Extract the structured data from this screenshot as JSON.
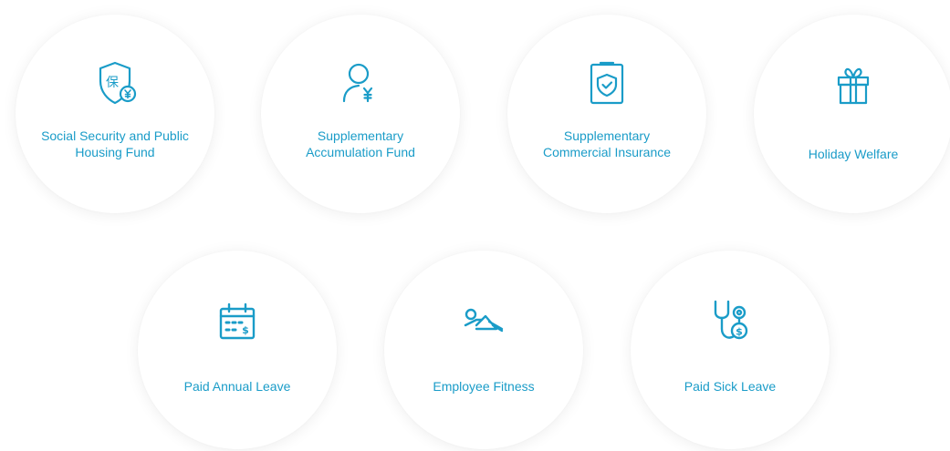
{
  "benefits": [
    {
      "line1": "Social Security and Public",
      "line2": "Housing Fund",
      "icon": "insurance-shield-yuan-icon"
    },
    {
      "line1": "Supplementary",
      "line2": "Accumulation Fund",
      "icon": "person-yuan-icon"
    },
    {
      "line1": "Supplementary",
      "line2": "Commercial Insurance",
      "icon": "clipboard-shield-icon"
    },
    {
      "line1": "Holiday Welfare",
      "icon": "gift-box-icon"
    },
    {
      "line1": "Paid Annual Leave",
      "icon": "calendar-dollar-icon"
    },
    {
      "line1": "Employee Fitness",
      "icon": "fitness-exercise-icon"
    },
    {
      "line1": "Paid Sick Leave",
      "icon": "stethoscope-dollar-icon"
    }
  ],
  "colors": {
    "accent": "#1a9cc8",
    "card_background": "#ffffff",
    "page_background": "#ffffff"
  }
}
